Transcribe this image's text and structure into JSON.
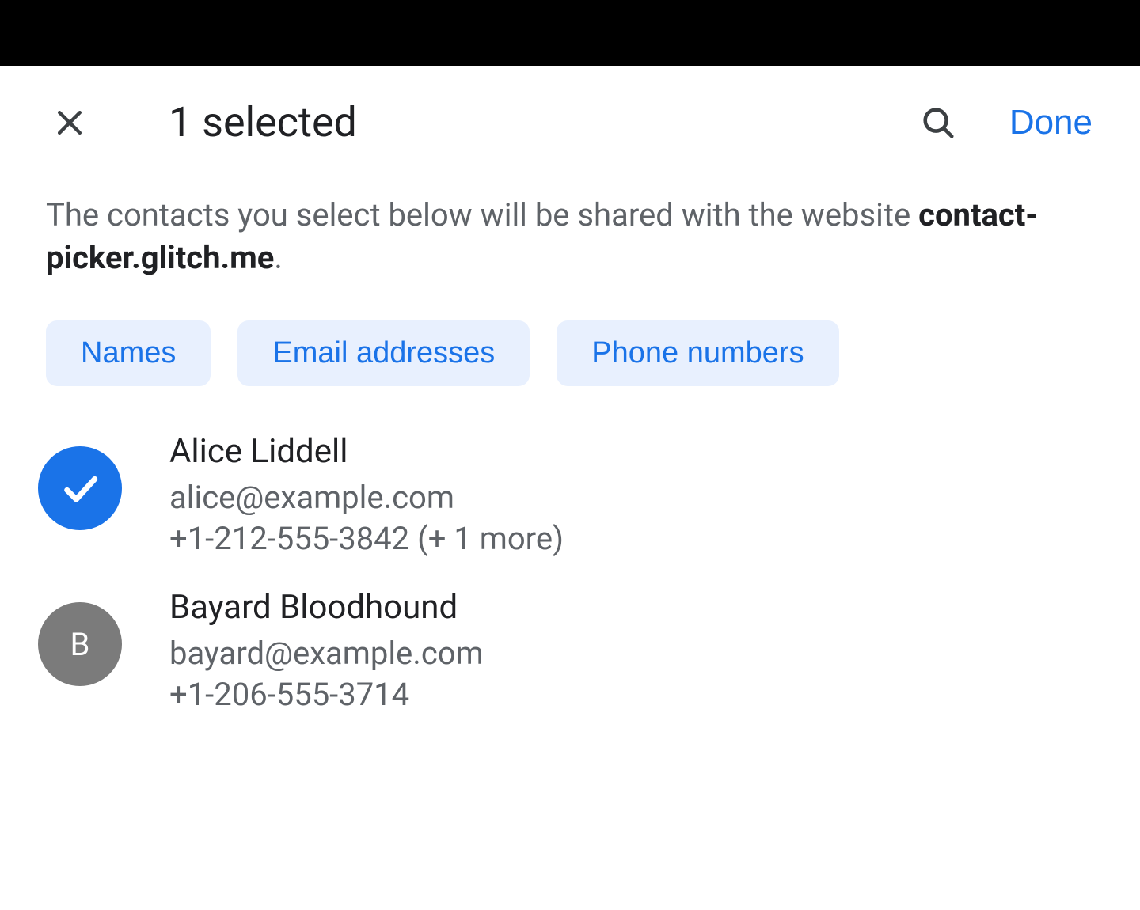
{
  "header": {
    "title": "1 selected",
    "done_label": "Done"
  },
  "description": {
    "prefix": "The contacts you select below will be shared with the website ",
    "site": "contact-picker.glitch.me",
    "suffix": "."
  },
  "chips": [
    {
      "label": "Names"
    },
    {
      "label": "Email addresses"
    },
    {
      "label": "Phone numbers"
    }
  ],
  "contacts": [
    {
      "selected": true,
      "name": "Alice Liddell",
      "email": "alice@example.com",
      "phone": "+1-212-555-3842 (+ 1 more)"
    },
    {
      "selected": false,
      "initial": "B",
      "name": "Bayard Bloodhound",
      "email": "bayard@example.com",
      "phone": "+1-206-555-3714"
    }
  ],
  "colors": {
    "accent": "#1a73e8",
    "chip_bg": "#e8f0fe",
    "text_primary": "#202124",
    "text_secondary": "#5f6368",
    "avatar_gray": "#7b7b7b"
  }
}
